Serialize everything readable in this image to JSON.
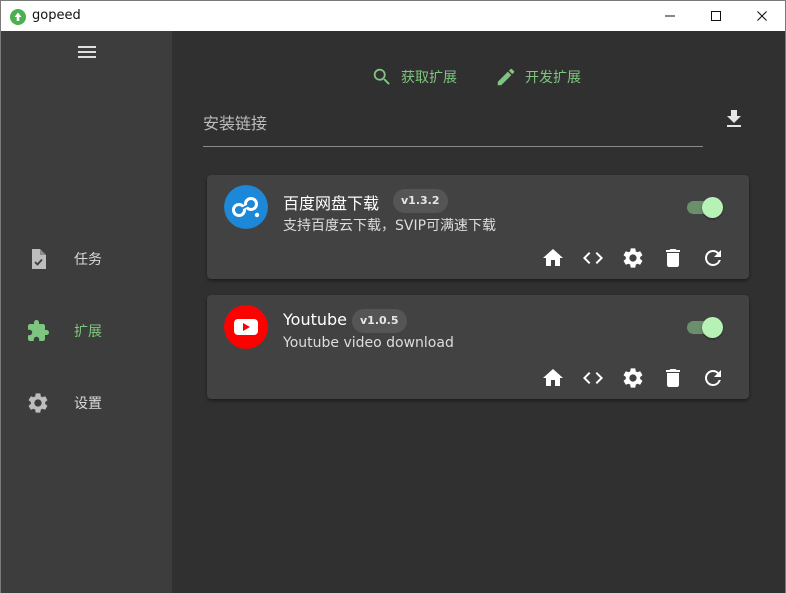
{
  "window": {
    "title": "gopeed",
    "logo_icon": "gopeed-logo-icon",
    "controls": [
      "minimize-icon",
      "maximize-icon",
      "close-icon"
    ]
  },
  "sidebar": {
    "menu_icon": "hamburger-menu-icon",
    "items": [
      {
        "label": "任务",
        "icon": "task-file-icon",
        "active": false
      },
      {
        "label": "扩展",
        "icon": "puzzle-icon",
        "active": true
      },
      {
        "label": "设置",
        "icon": "gear-icon",
        "active": false
      }
    ]
  },
  "main": {
    "actions": [
      {
        "label": "获取扩展",
        "icon": "search-icon"
      },
      {
        "label": "开发扩展",
        "icon": "pencil-icon"
      }
    ],
    "install": {
      "placeholder": "安装链接",
      "value": "",
      "button_icon": "download-icon"
    },
    "extensions": [
      {
        "name": "百度网盘下载",
        "version": "v1.3.2",
        "description": "支持百度云下载，SVIP可满速下载",
        "icon": "baidu-netdisk-icon",
        "enabled": true
      },
      {
        "name": "Youtube",
        "version": "v1.0.5",
        "description": "Youtube video download",
        "icon": "youtube-icon",
        "enabled": true
      }
    ],
    "card_tools": [
      "home-icon",
      "code-icon",
      "gear-icon",
      "trash-icon",
      "refresh-icon"
    ]
  },
  "colors": {
    "accent": "#7ec57f",
    "sidebar_bg": "#3d3d3d",
    "main_bg": "#303030",
    "card_bg": "#424242",
    "toggle_knob": "#b6f2b5"
  }
}
